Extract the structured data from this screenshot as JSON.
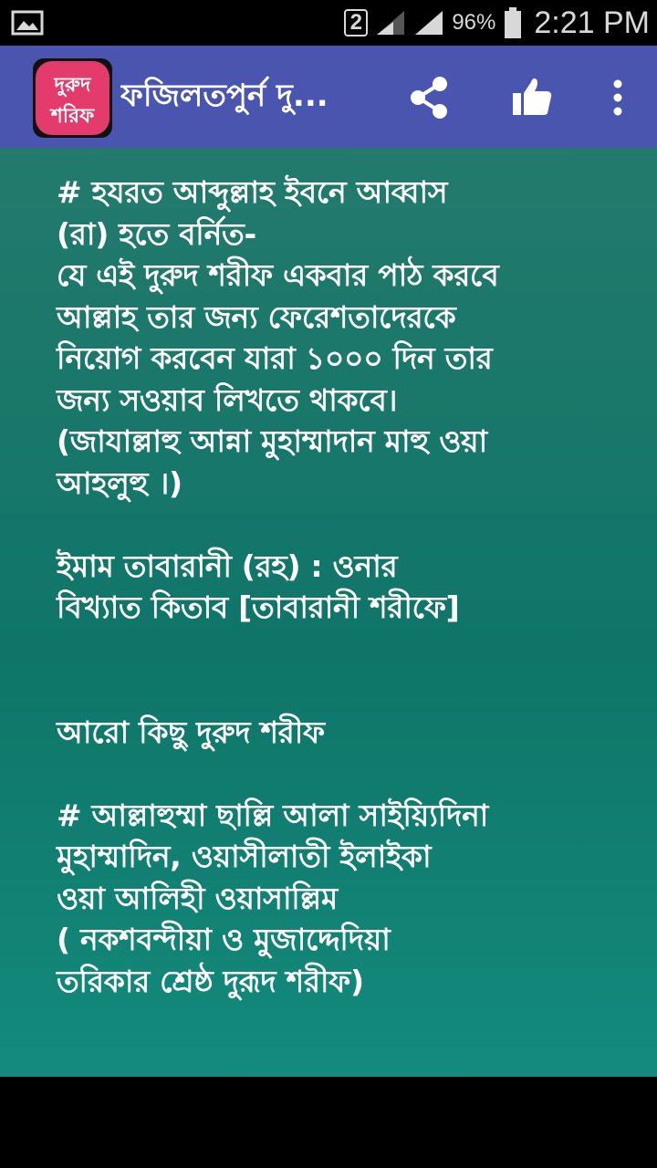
{
  "status_bar": {
    "sim_label": "2",
    "battery_percent": "96%",
    "time": "2:21 PM",
    "icons": [
      "image-icon",
      "sim-badge",
      "signal-icon",
      "signal-icon",
      "battery-icon"
    ]
  },
  "app_bar": {
    "logo_line1": "দুরুদ",
    "logo_line2": "শরিফ",
    "title": "ফজিলতপুর্ন দু...",
    "actions": [
      "share-icon",
      "thumbs-up-icon",
      "more-vert-icon"
    ],
    "colors": {
      "bar": "#4a55b0",
      "logo": "#e33b6c"
    }
  },
  "content": {
    "text": "# হযরত আব্দুল্লাহ ইবনে আব্বাস\n(রা) হতে বর্নিত-\nযে এই দুরুদ শরীফ একবার পাঠ করবে\nআল্লাহ তার জন্য ফেরেশতাদেরকে\nনিয়োগ করবেন যারা ১০০০ দিন তার\nজন্য সওয়াব লিখতে থাকবে।\n(জাযাল্লাহু আন্না মুহাম্মাদান মাহু ওয়া\nআহলুহু ।)\n\nইমাম তাবারানী (রহ) : ওনার\nবিখ্যাত কিতাব [তাবারানী শরীফে]\n\n\nআরো কিছু দুরুদ শরীফ\n\n# আল্লাহুম্মা ছাল্লি আলা সাইয়্যিদিনা\nমুহাম্মাদিন, ওয়াসীলাতী ইলাইকা\nওয়া আলিহী ওয়াসাল্লিম\n( নকশবন্দীয়া ও মুজাদ্দেদিয়া\nতরিকার শ্রেষ্ঠ দুরূদ শরীফ)",
    "colors": {
      "background": "#0f7569",
      "text": "#ffffff"
    }
  }
}
